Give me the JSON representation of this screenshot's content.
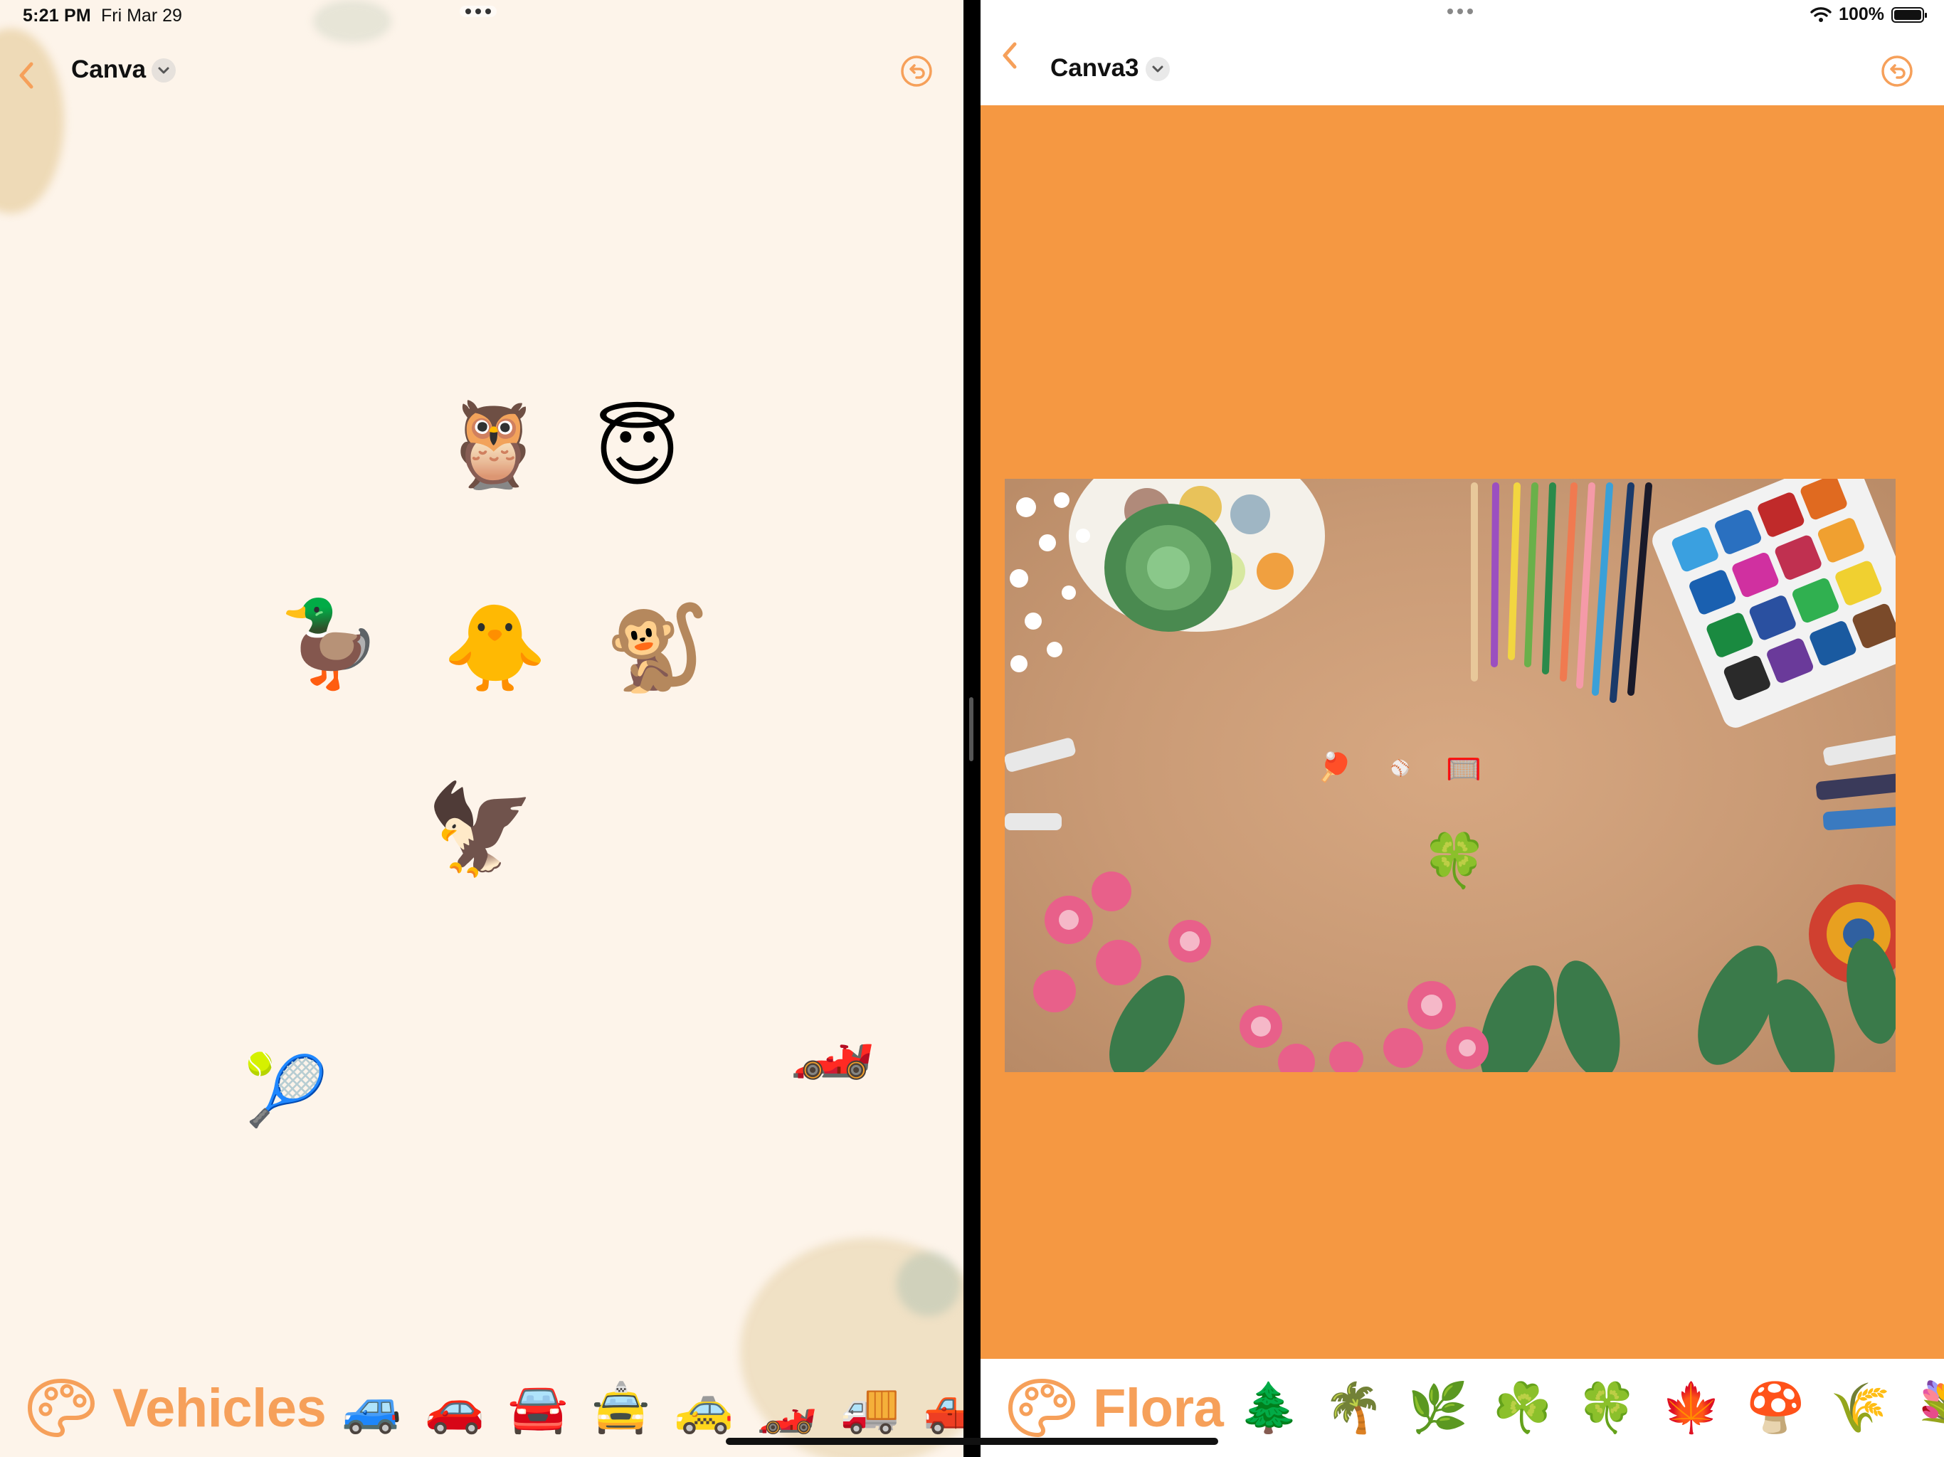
{
  "status": {
    "time": "5:21 PM",
    "date": "Fri Mar 29",
    "battery": "100%"
  },
  "left": {
    "title": "Canva",
    "category": "Vehicles",
    "bar_emojis": [
      "🚙",
      "🚗",
      "🚘",
      "🚖",
      "🚕",
      "🏎️",
      "🚚",
      "🛻"
    ],
    "canvas_items": [
      {
        "name": "owl",
        "emoji": "🦉"
      },
      {
        "name": "smiling-face-with-halo",
        "emoji": "😇"
      },
      {
        "name": "duck",
        "emoji": "🦆"
      },
      {
        "name": "baby-chick",
        "emoji": "🐥"
      },
      {
        "name": "monkey",
        "emoji": "🐒"
      },
      {
        "name": "eagle",
        "emoji": "🦅"
      },
      {
        "name": "racing-car",
        "emoji": "🏎️"
      },
      {
        "name": "tennis-ball",
        "emoji": "🎾"
      }
    ]
  },
  "right": {
    "title": "Canva3",
    "category": "Flora",
    "bar_emojis": [
      "🌲",
      "🌴",
      "🌿",
      "☘️",
      "🍀",
      "🍁",
      "🍄",
      "🌾",
      "💐"
    ],
    "canvas_items": [
      {
        "name": "ping-pong",
        "emoji": "🏓"
      },
      {
        "name": "baseball",
        "emoji": "⚾"
      },
      {
        "name": "goal-net",
        "emoji": "🥅"
      },
      {
        "name": "four-leaf-clover",
        "emoji": "🍀"
      }
    ],
    "canvas_color": "#f59842"
  },
  "accent_color": "#f6a05a"
}
